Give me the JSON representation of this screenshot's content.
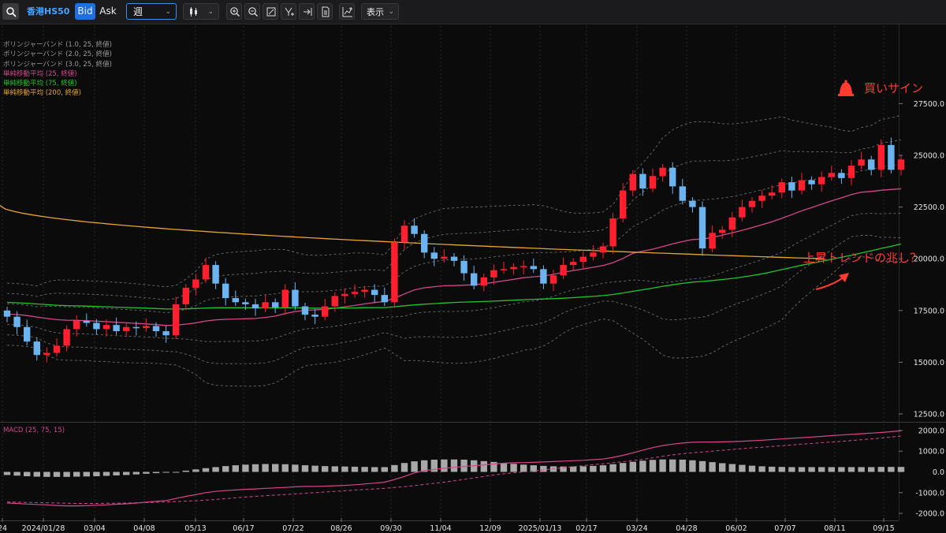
{
  "toolbar": {
    "symbol": "香港HS50",
    "bid_label": "Bid",
    "ask_label": "Ask",
    "period_value": "週",
    "display_label": "表示"
  },
  "legend": [
    {
      "text": "ボリンジャーバンド (1.0, 25, 終値)",
      "color": "#9a9a9a"
    },
    {
      "text": "ボリンジャーバンド (2.0, 25, 終値)",
      "color": "#9a9a9a"
    },
    {
      "text": "ボリンジャーバンド (3.0, 25, 終値)",
      "color": "#9a9a9a"
    },
    {
      "text": "単純移動平均 (25, 終値)",
      "color": "#d4478a"
    },
    {
      "text": "単純移動平均 (75, 終値)",
      "color": "#22c52a"
    },
    {
      "text": "単純移動平均 (200, 終値)",
      "color": "#e7a531"
    }
  ],
  "annotations": {
    "buy_sign": "買いサイン",
    "trend_note": "上昇トレンドの兆し？"
  },
  "colors": {
    "up": "#ff1f2e",
    "down": "#6cb4f0",
    "sma25": "#d4478a",
    "sma75": "#22c52a",
    "sma200": "#e7a531",
    "bands": "#8c8c8c",
    "annotation": "#ff3b30"
  },
  "chart_data": [
    {
      "type": "candlestick",
      "ylim": [
        12000,
        28000
      ],
      "y_ticks": [
        "12500.0",
        "15000.0",
        "17500.0",
        "20000.0",
        "22500.0",
        "25000.0",
        "27500.0"
      ],
      "x_tick_labels": [
        "24",
        "2024/01/28",
        "03/04",
        "04/08",
        "05/13",
        "06/17",
        "07/22",
        "08/26",
        "09/30",
        "11/04",
        "12/09",
        "2025/01/13",
        "02/17",
        "03/24",
        "04/28",
        "06/02",
        "07/07",
        "08/11",
        "09/15"
      ],
      "close": [
        17200,
        16700,
        16000,
        15350,
        15450,
        15800,
        16600,
        17000,
        16900,
        16600,
        16800,
        16500,
        16700,
        16650,
        16750,
        16500,
        16300,
        17800,
        18600,
        19000,
        19700,
        18800,
        18100,
        17900,
        17800,
        17600,
        17900,
        17650,
        18500,
        17700,
        17300,
        17200,
        17700,
        18200,
        18300,
        18400,
        18500,
        18250,
        17900,
        20800,
        21600,
        21200,
        20300,
        20000,
        20100,
        19900,
        19300,
        18700,
        19100,
        19450,
        19500,
        19600,
        19650,
        19500,
        18800,
        19200,
        19700,
        19850,
        20100,
        20300,
        20600,
        21950,
        23300,
        24100,
        23400,
        24000,
        24400,
        23500,
        22800,
        22500,
        20500,
        21250,
        21400,
        22000,
        22500,
        22800,
        23050,
        23200,
        23700,
        23300,
        23800,
        23600,
        23950,
        24150,
        23900,
        24500,
        24800,
        24300,
        25500,
        24300,
        24800
      ]
    },
    {
      "type": "macd",
      "title": "MACD (25, 75, 15)",
      "ylim": [
        -2000,
        2000
      ],
      "y_ticks": [
        "-2000.0",
        "-1000.0",
        "0.0",
        "1000.0",
        "2000.0"
      ],
      "macd": [
        -1500,
        -1520,
        -1550,
        -1570,
        -1590,
        -1620,
        -1640,
        -1640,
        -1630,
        -1610,
        -1590,
        -1560,
        -1540,
        -1500,
        -1460,
        -1420,
        -1380,
        -1280,
        -1180,
        -1100,
        -1000,
        -940,
        -900,
        -870,
        -840,
        -820,
        -790,
        -770,
        -750,
        -720,
        -700,
        -700,
        -690,
        -670,
        -650,
        -620,
        -580,
        -540,
        -500,
        -370,
        -220,
        -50,
        60,
        120,
        170,
        220,
        260,
        300,
        340,
        380,
        420,
        440,
        450,
        460,
        480,
        500,
        520,
        540,
        560,
        590,
        620,
        700,
        800,
        920,
        1050,
        1170,
        1270,
        1340,
        1390,
        1430,
        1440,
        1440,
        1450,
        1460,
        1480,
        1500,
        1530,
        1560,
        1590,
        1620,
        1650,
        1680,
        1710,
        1750,
        1780,
        1810,
        1840,
        1870,
        1900,
        1940,
        1980
      ],
      "signal": [
        -1450,
        -1460,
        -1470,
        -1480,
        -1490,
        -1500,
        -1510,
        -1520,
        -1520,
        -1520,
        -1515,
        -1510,
        -1500,
        -1490,
        -1480,
        -1465,
        -1450,
        -1430,
        -1410,
        -1390,
        -1360,
        -1330,
        -1290,
        -1250,
        -1210,
        -1180,
        -1150,
        -1120,
        -1090,
        -1060,
        -1030,
        -1000,
        -970,
        -940,
        -910,
        -880,
        -850,
        -820,
        -790,
        -750,
        -710,
        -660,
        -610,
        -550,
        -490,
        -430,
        -360,
        -290,
        -220,
        -150,
        -90,
        -40,
        0,
        50,
        100,
        150,
        200,
        250,
        300,
        350,
        390,
        440,
        490,
        550,
        610,
        680,
        750,
        820,
        880,
        920,
        960,
        1000,
        1040,
        1080,
        1120,
        1160,
        1190,
        1230,
        1260,
        1300,
        1340,
        1370,
        1410,
        1440,
        1470,
        1510,
        1550,
        1590,
        1630,
        1680,
        1730
      ],
      "histogram": [
        -150,
        -180,
        -210,
        -230,
        -240,
        -240,
        -240,
        -230,
        -220,
        -210,
        -190,
        -170,
        -150,
        -120,
        -90,
        -60,
        -30,
        0,
        60,
        120,
        180,
        230,
        280,
        320,
        350,
        370,
        380,
        380,
        370,
        350,
        320,
        300,
        280,
        270,
        260,
        250,
        240,
        230,
        230,
        330,
        430,
        510,
        560,
        590,
        600,
        600,
        590,
        560,
        520,
        480,
        430,
        390,
        350,
        320,
        290,
        270,
        260,
        260,
        270,
        290,
        320,
        370,
        430,
        490,
        540,
        580,
        600,
        600,
        590,
        560,
        520,
        470,
        420,
        380,
        340,
        300,
        270,
        250,
        240,
        230,
        230,
        230,
        230,
        230,
        230,
        230,
        230,
        230,
        240,
        240,
        240
      ]
    }
  ]
}
